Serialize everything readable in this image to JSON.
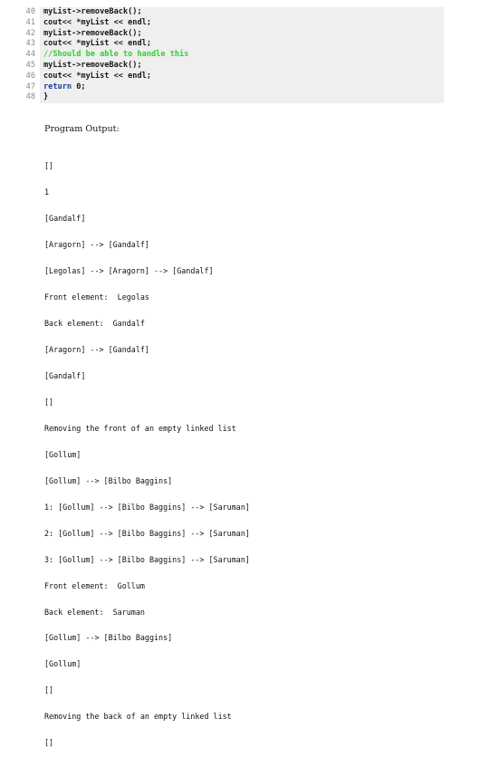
{
  "code_lines": [
    {
      "num": "40",
      "text": "myList->removeBack();",
      "kind": "normal"
    },
    {
      "num": "41",
      "text": "cout<< *myList << endl;",
      "kind": "normal"
    },
    {
      "num": "42",
      "text": "myList->removeBack();",
      "kind": "normal"
    },
    {
      "num": "43",
      "text": "cout<< *myList << endl;",
      "kind": "normal"
    },
    {
      "num": "44",
      "text": "//Should be able to handle this",
      "kind": "comment"
    },
    {
      "num": "45",
      "text": "myList->removeBack();",
      "kind": "normal"
    },
    {
      "num": "46",
      "text": "cout<< *myList << endl;",
      "kind": "normal"
    },
    {
      "num": "47",
      "text_kw": "return",
      "text_rest": " 0;",
      "kind": "keyword"
    },
    {
      "num": "48",
      "text": "}",
      "kind": "normal"
    }
  ],
  "output_heading": "Program Output:",
  "output_lines": [
    "[]",
    "1",
    "[Gandalf]",
    "[Aragorn] --> [Gandalf]",
    "[Legolas] --> [Aragorn] --> [Gandalf]",
    "Front element:  Legolas",
    "Back element:  Gandalf",
    "[Aragorn] --> [Gandalf]",
    "[Gandalf]",
    "[]",
    "Removing the front of an empty linked list",
    "[Gollum]",
    "[Gollum] --> [Bilbo Baggins]",
    "1: [Gollum] --> [Bilbo Baggins] --> [Saruman]",
    "2: [Gollum] --> [Bilbo Baggins] --> [Saruman]",
    "3: [Gollum] --> [Bilbo Baggins] --> [Saruman]",
    "Front element:  Gollum",
    "Back element:  Saruman",
    "[Gollum] --> [Bilbo Baggins]",
    "[Gollum]",
    "[]",
    "Removing the back of an empty linked list",
    "[]"
  ]
}
